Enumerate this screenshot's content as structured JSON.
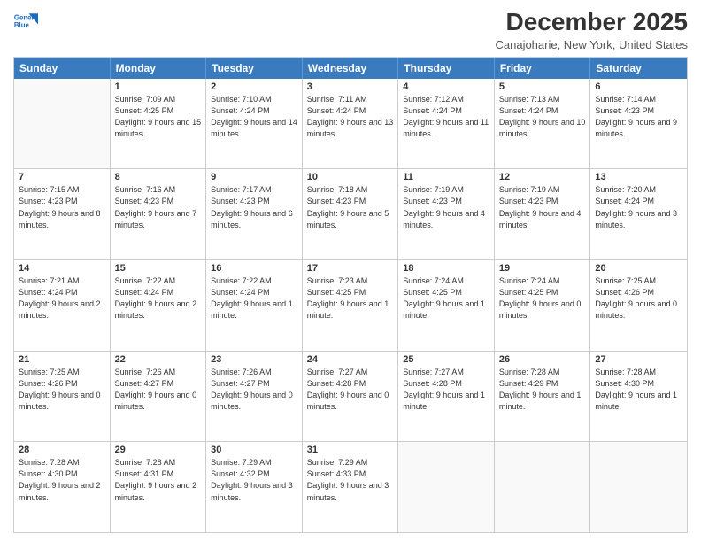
{
  "logo": {
    "line1": "General",
    "line2": "Blue"
  },
  "title": "December 2025",
  "subtitle": "Canajoharie, New York, United States",
  "weekdays": [
    "Sunday",
    "Monday",
    "Tuesday",
    "Wednesday",
    "Thursday",
    "Friday",
    "Saturday"
  ],
  "rows": [
    [
      {
        "day": "",
        "sunrise": "",
        "sunset": "",
        "daylight": "",
        "empty": true
      },
      {
        "day": "1",
        "sunrise": "Sunrise: 7:09 AM",
        "sunset": "Sunset: 4:25 PM",
        "daylight": "Daylight: 9 hours and 15 minutes."
      },
      {
        "day": "2",
        "sunrise": "Sunrise: 7:10 AM",
        "sunset": "Sunset: 4:24 PM",
        "daylight": "Daylight: 9 hours and 14 minutes."
      },
      {
        "day": "3",
        "sunrise": "Sunrise: 7:11 AM",
        "sunset": "Sunset: 4:24 PM",
        "daylight": "Daylight: 9 hours and 13 minutes."
      },
      {
        "day": "4",
        "sunrise": "Sunrise: 7:12 AM",
        "sunset": "Sunset: 4:24 PM",
        "daylight": "Daylight: 9 hours and 11 minutes."
      },
      {
        "day": "5",
        "sunrise": "Sunrise: 7:13 AM",
        "sunset": "Sunset: 4:24 PM",
        "daylight": "Daylight: 9 hours and 10 minutes."
      },
      {
        "day": "6",
        "sunrise": "Sunrise: 7:14 AM",
        "sunset": "Sunset: 4:23 PM",
        "daylight": "Daylight: 9 hours and 9 minutes."
      }
    ],
    [
      {
        "day": "7",
        "sunrise": "Sunrise: 7:15 AM",
        "sunset": "Sunset: 4:23 PM",
        "daylight": "Daylight: 9 hours and 8 minutes."
      },
      {
        "day": "8",
        "sunrise": "Sunrise: 7:16 AM",
        "sunset": "Sunset: 4:23 PM",
        "daylight": "Daylight: 9 hours and 7 minutes."
      },
      {
        "day": "9",
        "sunrise": "Sunrise: 7:17 AM",
        "sunset": "Sunset: 4:23 PM",
        "daylight": "Daylight: 9 hours and 6 minutes."
      },
      {
        "day": "10",
        "sunrise": "Sunrise: 7:18 AM",
        "sunset": "Sunset: 4:23 PM",
        "daylight": "Daylight: 9 hours and 5 minutes."
      },
      {
        "day": "11",
        "sunrise": "Sunrise: 7:19 AM",
        "sunset": "Sunset: 4:23 PM",
        "daylight": "Daylight: 9 hours and 4 minutes."
      },
      {
        "day": "12",
        "sunrise": "Sunrise: 7:19 AM",
        "sunset": "Sunset: 4:23 PM",
        "daylight": "Daylight: 9 hours and 4 minutes."
      },
      {
        "day": "13",
        "sunrise": "Sunrise: 7:20 AM",
        "sunset": "Sunset: 4:24 PM",
        "daylight": "Daylight: 9 hours and 3 minutes."
      }
    ],
    [
      {
        "day": "14",
        "sunrise": "Sunrise: 7:21 AM",
        "sunset": "Sunset: 4:24 PM",
        "daylight": "Daylight: 9 hours and 2 minutes."
      },
      {
        "day": "15",
        "sunrise": "Sunrise: 7:22 AM",
        "sunset": "Sunset: 4:24 PM",
        "daylight": "Daylight: 9 hours and 2 minutes."
      },
      {
        "day": "16",
        "sunrise": "Sunrise: 7:22 AM",
        "sunset": "Sunset: 4:24 PM",
        "daylight": "Daylight: 9 hours and 1 minute."
      },
      {
        "day": "17",
        "sunrise": "Sunrise: 7:23 AM",
        "sunset": "Sunset: 4:25 PM",
        "daylight": "Daylight: 9 hours and 1 minute."
      },
      {
        "day": "18",
        "sunrise": "Sunrise: 7:24 AM",
        "sunset": "Sunset: 4:25 PM",
        "daylight": "Daylight: 9 hours and 1 minute."
      },
      {
        "day": "19",
        "sunrise": "Sunrise: 7:24 AM",
        "sunset": "Sunset: 4:25 PM",
        "daylight": "Daylight: 9 hours and 0 minutes."
      },
      {
        "day": "20",
        "sunrise": "Sunrise: 7:25 AM",
        "sunset": "Sunset: 4:26 PM",
        "daylight": "Daylight: 9 hours and 0 minutes."
      }
    ],
    [
      {
        "day": "21",
        "sunrise": "Sunrise: 7:25 AM",
        "sunset": "Sunset: 4:26 PM",
        "daylight": "Daylight: 9 hours and 0 minutes."
      },
      {
        "day": "22",
        "sunrise": "Sunrise: 7:26 AM",
        "sunset": "Sunset: 4:27 PM",
        "daylight": "Daylight: 9 hours and 0 minutes."
      },
      {
        "day": "23",
        "sunrise": "Sunrise: 7:26 AM",
        "sunset": "Sunset: 4:27 PM",
        "daylight": "Daylight: 9 hours and 0 minutes."
      },
      {
        "day": "24",
        "sunrise": "Sunrise: 7:27 AM",
        "sunset": "Sunset: 4:28 PM",
        "daylight": "Daylight: 9 hours and 0 minutes."
      },
      {
        "day": "25",
        "sunrise": "Sunrise: 7:27 AM",
        "sunset": "Sunset: 4:28 PM",
        "daylight": "Daylight: 9 hours and 1 minute."
      },
      {
        "day": "26",
        "sunrise": "Sunrise: 7:28 AM",
        "sunset": "Sunset: 4:29 PM",
        "daylight": "Daylight: 9 hours and 1 minute."
      },
      {
        "day": "27",
        "sunrise": "Sunrise: 7:28 AM",
        "sunset": "Sunset: 4:30 PM",
        "daylight": "Daylight: 9 hours and 1 minute."
      }
    ],
    [
      {
        "day": "28",
        "sunrise": "Sunrise: 7:28 AM",
        "sunset": "Sunset: 4:30 PM",
        "daylight": "Daylight: 9 hours and 2 minutes."
      },
      {
        "day": "29",
        "sunrise": "Sunrise: 7:28 AM",
        "sunset": "Sunset: 4:31 PM",
        "daylight": "Daylight: 9 hours and 2 minutes."
      },
      {
        "day": "30",
        "sunrise": "Sunrise: 7:29 AM",
        "sunset": "Sunset: 4:32 PM",
        "daylight": "Daylight: 9 hours and 3 minutes."
      },
      {
        "day": "31",
        "sunrise": "Sunrise: 7:29 AM",
        "sunset": "Sunset: 4:33 PM",
        "daylight": "Daylight: 9 hours and 3 minutes."
      },
      {
        "day": "",
        "sunrise": "",
        "sunset": "",
        "daylight": "",
        "empty": true
      },
      {
        "day": "",
        "sunrise": "",
        "sunset": "",
        "daylight": "",
        "empty": true
      },
      {
        "day": "",
        "sunrise": "",
        "sunset": "",
        "daylight": "",
        "empty": true
      }
    ]
  ]
}
